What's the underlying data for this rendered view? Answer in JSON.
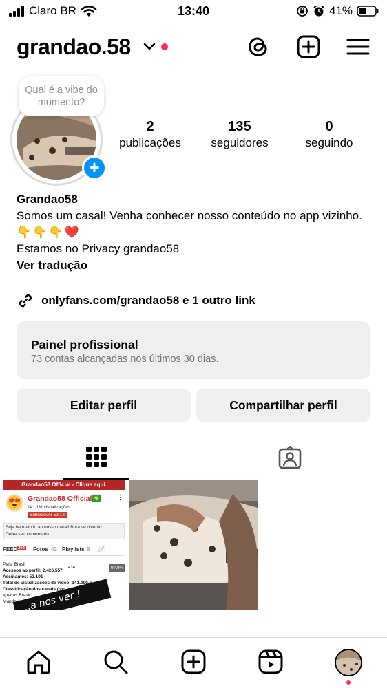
{
  "status_bar": {
    "carrier": "Claro BR",
    "time": "13:40",
    "battery": "41%"
  },
  "header": {
    "username": "grandao.58",
    "icons": [
      "threads-icon",
      "create-icon",
      "menu-icon"
    ]
  },
  "profile": {
    "note": "Qual é a vibe do momento?",
    "stats": [
      {
        "value": "2",
        "label": "publicações"
      },
      {
        "value": "135",
        "label": "seguidores"
      },
      {
        "value": "0",
        "label": "seguindo"
      }
    ],
    "display_name": "Grandao58",
    "bio_line1": "Somos um casal! Venha conhecer nosso conteúdo no app vizinho.",
    "bio_emojis": "👇👇👇❤️",
    "bio_line3": "Estamos no Privacy grandao58",
    "translate": "Ver tradução",
    "link": "onlyfans.com/grandao58 e 1 outro link"
  },
  "professional_panel": {
    "title": "Painel profissional",
    "subtitle": "73 contas alcançadas nos últimos 30 dias."
  },
  "buttons": {
    "edit": "Editar perfil",
    "share": "Compartilhar perfil"
  },
  "tabs": [
    "grid-icon",
    "tagged-icon"
  ],
  "posts": {
    "post1": {
      "banner": "Grandao58 Official - Clique aqui.",
      "channel": "Grandao58 Official",
      "views": "141,1M visualizações",
      "subscribe": "Subscrever 52,1 k",
      "welcome1": "Seja bem-vindo ao nosso canal! Bora se divertir!",
      "welcome2": "Deixe seu comentário...",
      "tab_a": "FEED",
      "tab_a_count": "364",
      "tab_b": "Fotos",
      "tab_b_count": "42",
      "tab_c": "Playlists",
      "tab_c_count": "8",
      "country": "País: Brasil",
      "profile_access": "Acessos ao perfil: 2.426.557",
      "subscribers": "Assinantes: 52.101",
      "total_views": "Total de visualizações de vídeo: 141.090.6...",
      "ranking": "Classificação dos canais (top...",
      "only_brazil": "apenas Brasil:",
      "world": "Mundo #...",
      "likes": "414",
      "meter": "97,9%",
      "sticker": "...a nos ver !"
    }
  },
  "bottom_nav": [
    "home-icon",
    "search-icon",
    "create-icon",
    "reels-icon",
    "profile-avatar"
  ]
}
